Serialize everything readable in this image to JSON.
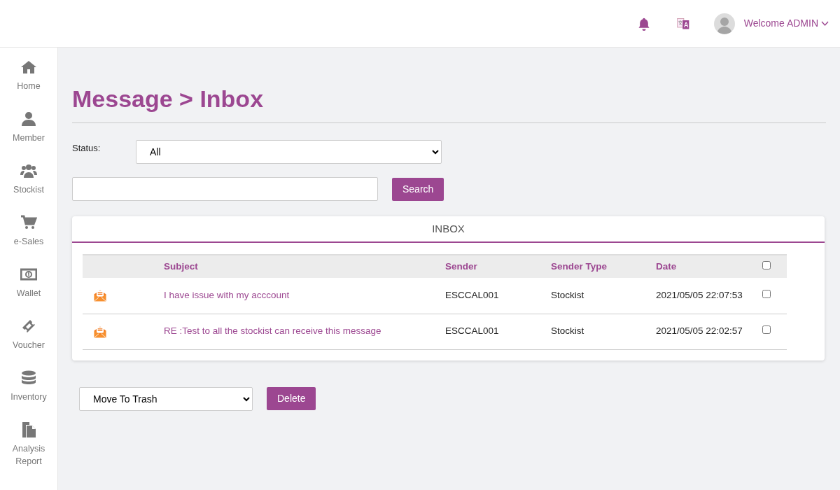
{
  "header": {
    "welcome": "Welcome ADMIN"
  },
  "sidebar": {
    "items": [
      {
        "label": "Home",
        "kind": "home"
      },
      {
        "label": "Member",
        "kind": "person"
      },
      {
        "label": "Stockist",
        "kind": "group"
      },
      {
        "label": "e-Sales",
        "kind": "cart"
      },
      {
        "label": "Wallet",
        "kind": "money"
      },
      {
        "label": "Voucher",
        "kind": "ticket"
      },
      {
        "label": "Inventory",
        "kind": "database"
      },
      {
        "label": "Analysis Report",
        "kind": "document"
      }
    ]
  },
  "page_title": "Message > Inbox",
  "filter": {
    "status_label": "Status:",
    "status_value": "All",
    "search_button": "Search"
  },
  "inbox": {
    "title": "INBOX",
    "columns": [
      "Subject",
      "Sender",
      "Sender Type",
      "Date"
    ],
    "select_all": {
      "checked": false
    },
    "rows": [
      {
        "subject": "I have issue with my acccount",
        "sender": "ESCCAL001",
        "sender_type": "Stockist",
        "date": "2021/05/05 22:07:53",
        "checked": false
      },
      {
        "subject": "RE :Test to all the stockist can receive this message",
        "sender": "ESCCAL001",
        "sender_type": "Stockist",
        "date": "2021/05/05 22:02:57",
        "checked": false
      }
    ]
  },
  "action": {
    "value": "Move To Trash",
    "button": "Delete"
  }
}
